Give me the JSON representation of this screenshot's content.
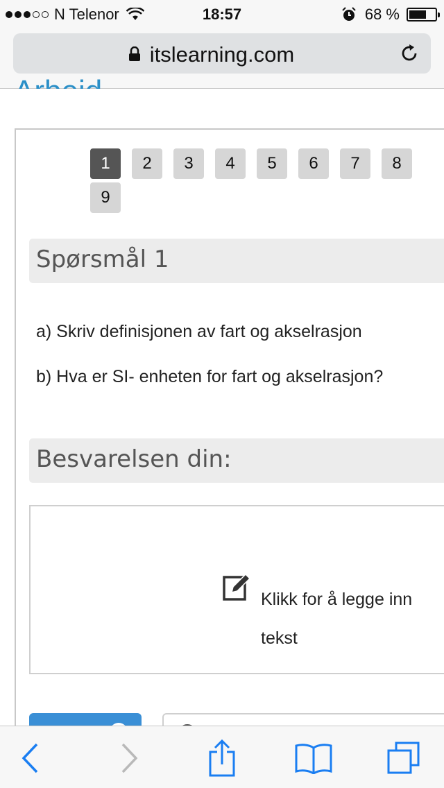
{
  "status_bar": {
    "carrier": "N Telenor",
    "time": "18:57",
    "battery_percent": "68 %",
    "signal_bars_filled": 3,
    "signal_bars_total": 5,
    "battery_level": 0.68
  },
  "browser": {
    "url": "itslearning.com"
  },
  "page": {
    "cut_heading": "Arbeid",
    "pages": [
      "1",
      "2",
      "3",
      "4",
      "5",
      "6",
      "7",
      "8",
      "9"
    ],
    "active_page": "1",
    "question_title": "Spørsmål 1",
    "question_lines": [
      "a) Skriv definisjonen av fart og akselrasjon",
      "b) Hva er SI- enheten for fart og akselrasjon?"
    ],
    "answer_title": "Besvarelsen din:",
    "answer_placeholder": "Klikk for å legge inn tekst"
  },
  "colors": {
    "accent": "#2b8fc7",
    "button_blue": "#3a8fd6",
    "ios_blue": "#1a7ef2",
    "active_page": "#555555"
  },
  "icons": {
    "lock": "lock-icon",
    "reload": "reload-icon",
    "edit": "edit-icon",
    "back": "chevron-left-icon",
    "forward": "chevron-right-icon",
    "share": "share-icon",
    "bookmarks": "book-icon",
    "tabs": "tabs-icon"
  }
}
